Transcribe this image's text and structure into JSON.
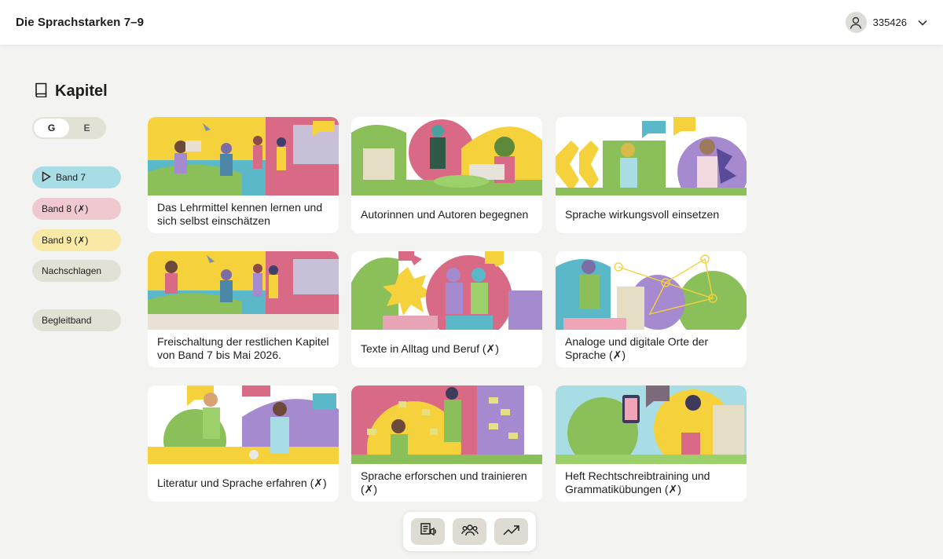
{
  "header": {
    "app_title": "Die Sprachstarken 7–9",
    "user_id": "335426",
    "user_icon": "user-icon",
    "menu_icon": "chevron-down-icon"
  },
  "section": {
    "title": "Kapitel",
    "icon": "book-icon"
  },
  "level_toggle": {
    "options": [
      "G",
      "E"
    ],
    "selected": "G"
  },
  "sidebar": {
    "items": [
      {
        "label": "Band 7",
        "color": "#a8dde5",
        "active": true
      },
      {
        "label": "Band 8 (✗)",
        "color": "#efc9cf",
        "active": false
      },
      {
        "label": "Band 9 (✗)",
        "color": "#f8e9a6",
        "active": false
      },
      {
        "label": "Nachschlagen",
        "color": "#e2e1d6",
        "active": false
      },
      {
        "label": "Begleitband",
        "color": "#e2e1d6",
        "active": false
      }
    ]
  },
  "chapters": [
    {
      "title": "Das Lehrmittel kennen lernen und sich selbst einschätzen"
    },
    {
      "title": "Autorinnen und Autoren begegnen"
    },
    {
      "title": "Sprache wirkungsvoll einsetzen"
    },
    {
      "title": "Freischaltung der restlichen Kapitel von Band 7 bis Mai 2026."
    },
    {
      "title": "Texte in Alltag und Beruf (✗)"
    },
    {
      "title": "Analoge und digitale Orte der Sprache (✗)"
    },
    {
      "title": "Literatur und Sprache erfahren (✗)"
    },
    {
      "title": "Sprache erforschen und trainieren (✗)"
    },
    {
      "title": "Heft Rechtschreibtraining und Grammatikübungen (✗)"
    }
  ],
  "dock": {
    "buttons": [
      {
        "icon": "read-aloud-icon"
      },
      {
        "icon": "group-icon"
      },
      {
        "icon": "progress-chart-icon"
      }
    ]
  },
  "colors": {
    "background": "#f3f3f1",
    "yellow": "#f5d13c",
    "pink": "#d96a86",
    "blue": "#5bb8c8",
    "green": "#8bbf5a",
    "purple": "#a58ad0"
  }
}
